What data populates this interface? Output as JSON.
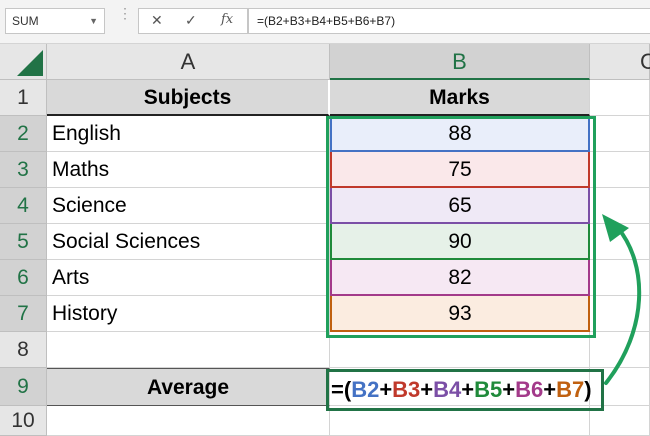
{
  "namebox": "SUM",
  "formula_bar": {
    "cancel_icon": "x-icon",
    "enter_icon": "check-icon",
    "fx_label": "fx",
    "formula": "=(B2+B3+B4+B5+B6+B7)"
  },
  "columns": [
    "A",
    "B",
    "C"
  ],
  "rows": [
    "1",
    "2",
    "3",
    "4",
    "5",
    "6",
    "7",
    "8",
    "9",
    "10"
  ],
  "table": {
    "header_subjects": "Subjects",
    "header_marks": "Marks",
    "subjects": [
      "English",
      "Maths",
      "Science",
      "Social Sciences",
      "Arts",
      "History"
    ],
    "marks": [
      "88",
      "75",
      "65",
      "90",
      "82",
      "93"
    ],
    "row_colors": [
      "#4472c4",
      "#c0392b",
      "#7b4fa6",
      "#1f8a3a",
      "#a33a8a",
      "#c0600f"
    ],
    "row_fills": [
      "#e9eefa",
      "#fae8ea",
      "#efe9f6",
      "#e6f1e8",
      "#f6e8f3",
      "#fbece0"
    ]
  },
  "average_label": "Average",
  "cell_formula": {
    "open": "=(",
    "refs": [
      "B2",
      "B3",
      "B4",
      "B5",
      "B6",
      "B7"
    ],
    "plus": "+",
    "close": ")",
    "paren_color": "#000000"
  },
  "accent_green": "#20a05c"
}
